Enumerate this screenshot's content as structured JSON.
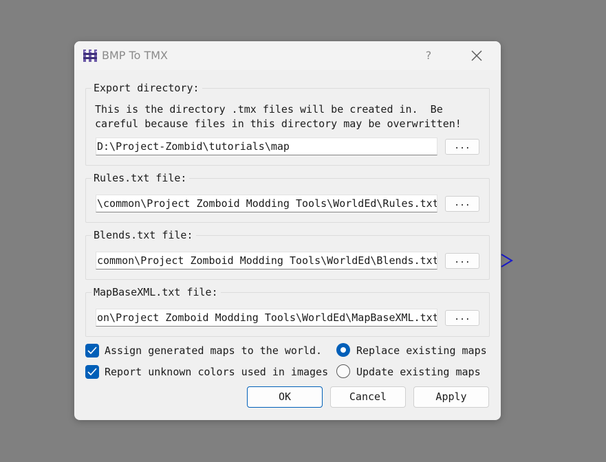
{
  "window": {
    "title": "BMP To TMX",
    "help_label": "?"
  },
  "icons": {
    "app": "app-logo-icon",
    "close": "close-icon",
    "check": "checkmark-icon",
    "arrow": "chevron-right-icon"
  },
  "colors": {
    "accent": "#005fb8",
    "background": "#808080",
    "dialog": "#f0f0f0"
  },
  "export_dir": {
    "label": "Export directory:",
    "description": "This is the directory .tmx files will be created in.  Be\ncareful because files in this directory may be overwritten!",
    "value": "D:\\Project-Zombid\\tutorials\\map",
    "browse_label": "..."
  },
  "rules_file": {
    "label": "Rules.txt file:",
    "value": "\\common\\Project Zomboid Modding Tools\\WorldEd\\Rules.txt",
    "browse_label": "..."
  },
  "blends_file": {
    "label": "Blends.txt file:",
    "value": "common\\Project Zomboid Modding Tools\\WorldEd\\Blends.txt",
    "browse_label": "..."
  },
  "mapbase_file": {
    "label": "MapBaseXML.txt file:",
    "value": "on\\Project Zomboid Modding Tools\\WorldEd\\MapBaseXML.txt",
    "browse_label": "..."
  },
  "options": {
    "assign_maps": {
      "label": "Assign generated maps to the world.",
      "checked": true
    },
    "report_colors": {
      "label": "Report unknown colors used in images",
      "checked": true
    },
    "replace_maps": {
      "label": "Replace existing maps",
      "selected": true
    },
    "update_maps": {
      "label": "Update existing maps",
      "selected": false
    }
  },
  "buttons": {
    "ok": "OK",
    "cancel": "Cancel",
    "apply": "Apply"
  }
}
